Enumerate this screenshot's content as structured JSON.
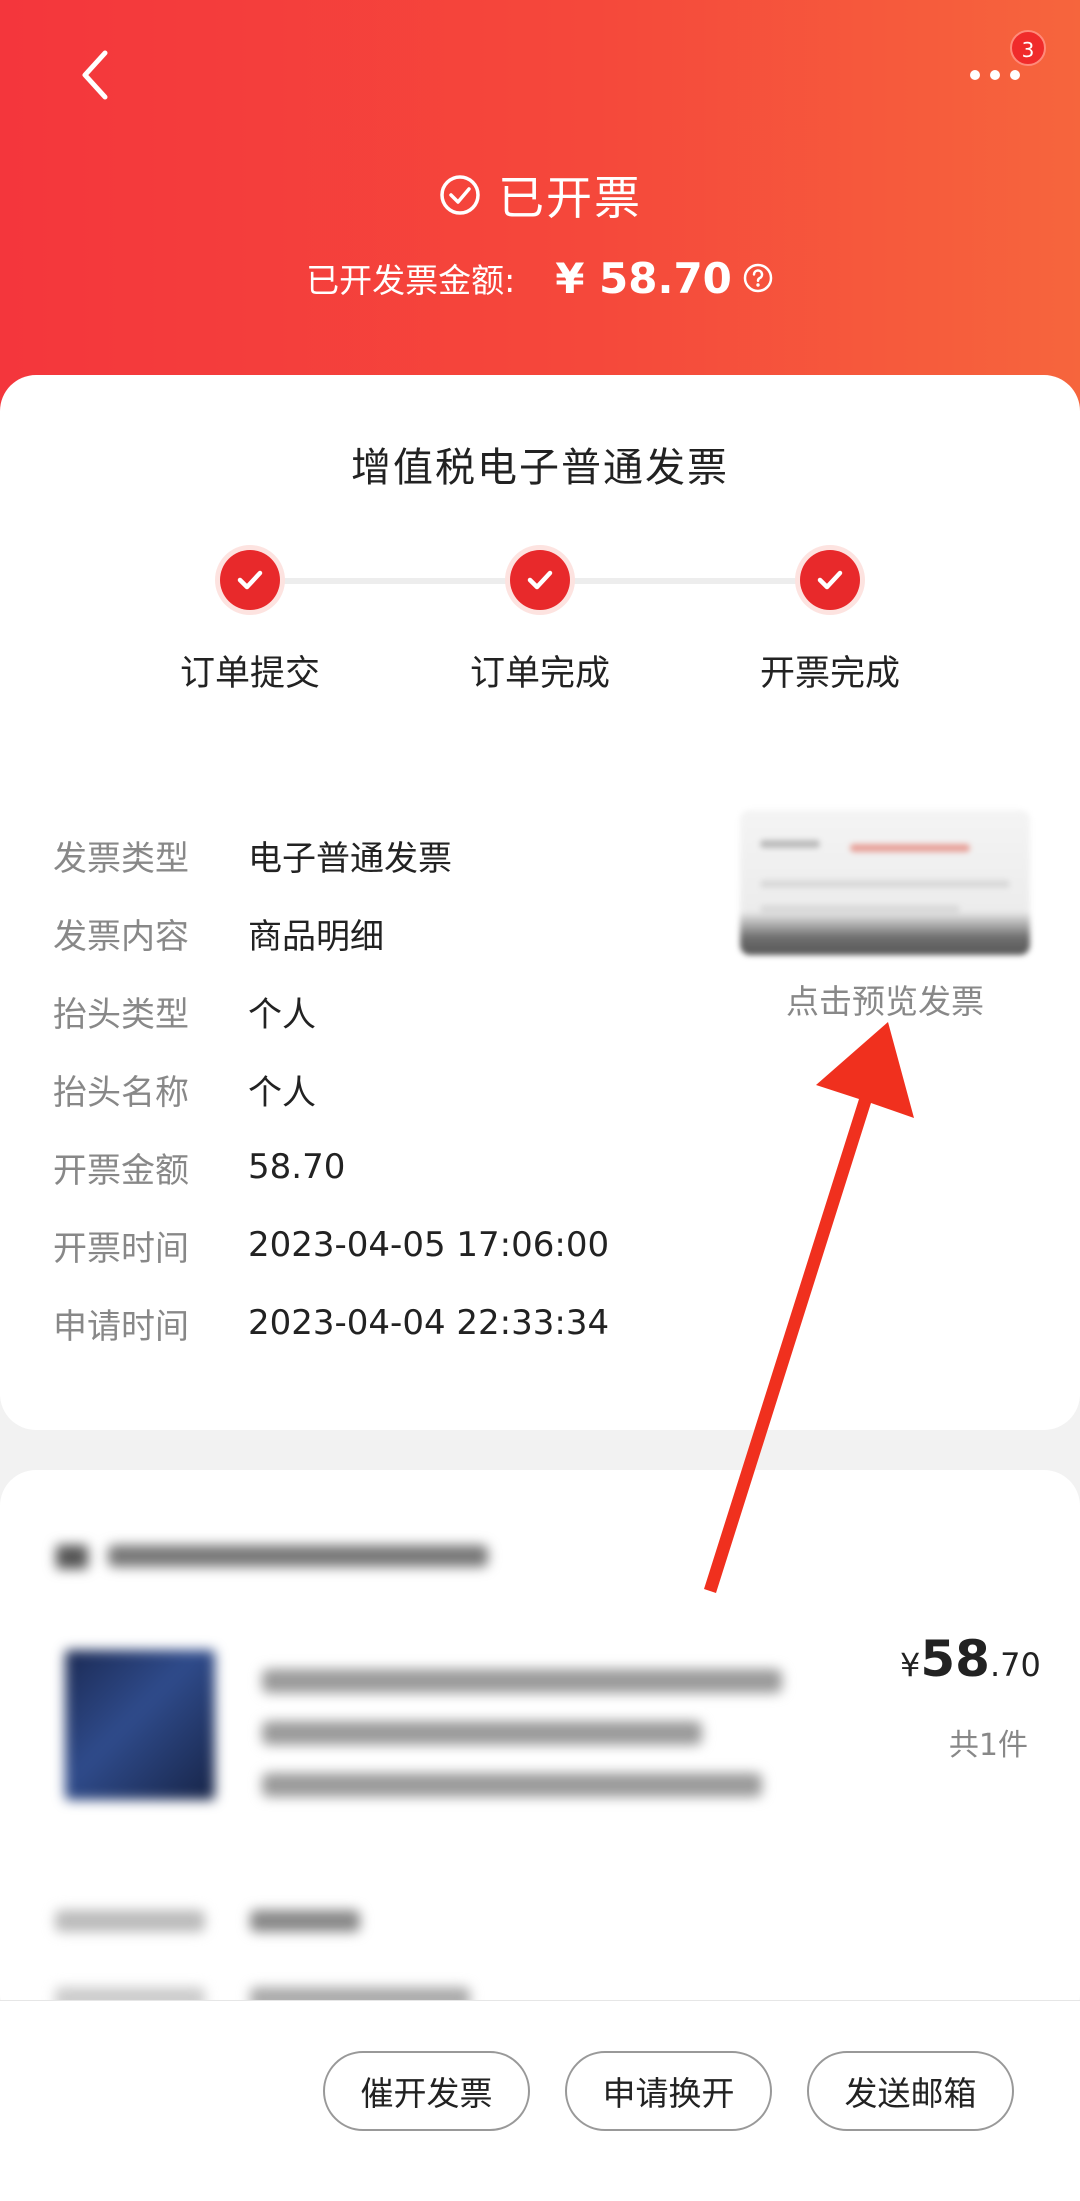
{
  "header": {
    "status_title": "已开票",
    "amount_label": "已开发票金额:",
    "amount_value": "¥ 58.70",
    "more_badge": "3",
    "colors": {
      "gradient_start": "#f4363c",
      "gradient_end": "#f6653d"
    },
    "icons": {
      "back": "chevron-left-icon",
      "more": "more-dots-icon",
      "status": "check-circle-icon",
      "help": "help-circle-icon"
    }
  },
  "invoice": {
    "title": "增值税电子普通发票",
    "steps": [
      {
        "label": "订单提交"
      },
      {
        "label": "订单完成"
      },
      {
        "label": "开票完成"
      }
    ],
    "fields": [
      {
        "key": "发票类型",
        "value": "电子普通发票"
      },
      {
        "key": "发票内容",
        "value": "商品明细"
      },
      {
        "key": "抬头类型",
        "value": "个人"
      },
      {
        "key": "抬头名称",
        "value": "个人"
      },
      {
        "key": "开票金额",
        "value": "58.70"
      },
      {
        "key": "开票时间",
        "value": "2023-04-05 17:06:00"
      },
      {
        "key": "申请时间",
        "value": "2023-04-04 22:33:34"
      }
    ],
    "preview_label": "点击预览发票",
    "accent_color": "#e8292b"
  },
  "order": {
    "price_symbol": "¥",
    "price_int": "58",
    "price_dec": ".70",
    "quantity": "共1件"
  },
  "actions": {
    "remind_label": "催开发票",
    "reissue_label": "申请换开",
    "email_label": "发送邮箱"
  }
}
